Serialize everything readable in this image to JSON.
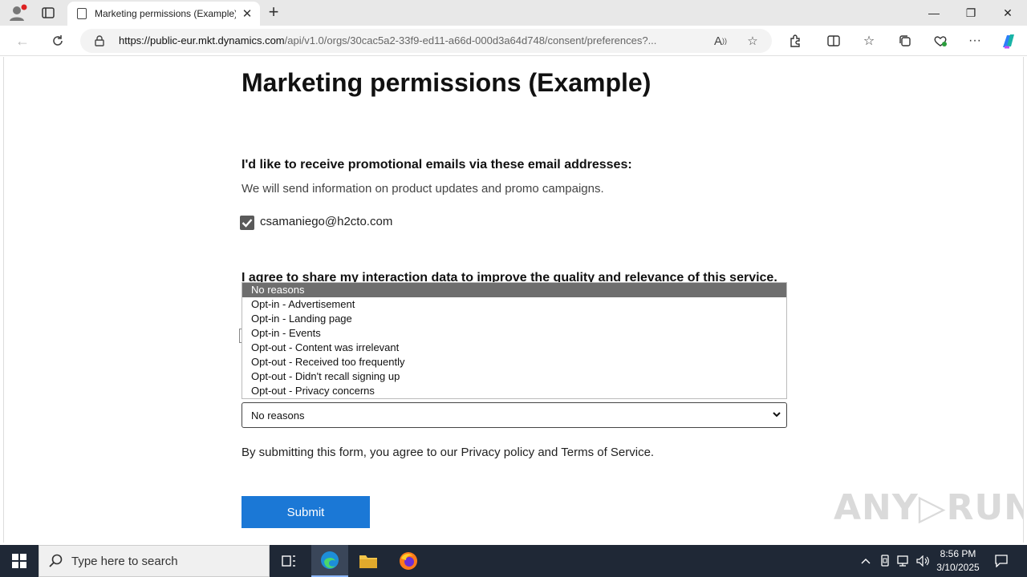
{
  "browser": {
    "tab_title": "Marketing permissions (Example)",
    "url_host": "https://public-eur.mkt.dynamics.com",
    "url_path": "/api/v1.0/orgs/30cac5a2-33f9-ed11-a66d-000d3a64d748/consent/preferences?..."
  },
  "page": {
    "title": "Marketing permissions (Example)",
    "email_question": "I'd like to receive promotional emails via these email addresses:",
    "email_description": "We will send information on product updates and promo campaigns.",
    "email_address": "csamaniego@h2cto.com",
    "email_checked": true,
    "interaction_question": "I agree to share my interaction data to improve the quality and relevance of this service.",
    "reason_options": [
      "No reasons",
      "Opt-in - Advertisement",
      "Opt-in - Landing page",
      "Opt-in - Events",
      "Opt-out - Content was irrelevant",
      "Opt-out - Received too frequently",
      "Opt-out - Didn't recall signing up",
      "Opt-out - Privacy concerns"
    ],
    "reason_selected": "No reasons",
    "terms_text": "By submitting this form, you agree to our Privacy policy and Terms of Service.",
    "submit_label": "Submit"
  },
  "watermark": "ANY RUN",
  "taskbar": {
    "search_placeholder": "Type here to search",
    "time": "8:56 PM",
    "date": "3/10/2025"
  },
  "colors": {
    "accent": "#1b78d6",
    "taskbar": "#1f2836",
    "selected_option": "#6e6e6e"
  }
}
